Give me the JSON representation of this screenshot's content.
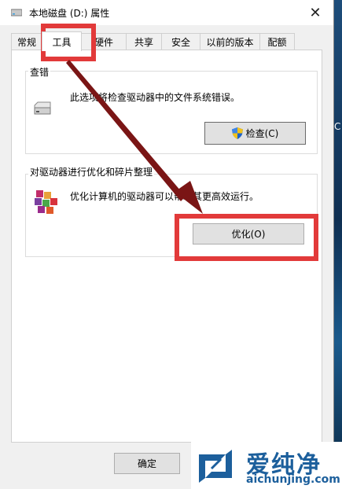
{
  "window": {
    "title": "本地磁盘 (D:) 属性",
    "close_glyph": "✕"
  },
  "tabs": [
    {
      "label": "常规"
    },
    {
      "label": "工具",
      "active": true
    },
    {
      "label": "硬件"
    },
    {
      "label": "共享"
    },
    {
      "label": "安全"
    },
    {
      "label": "以前的版本"
    },
    {
      "label": "配额"
    }
  ],
  "error_check": {
    "group_label": "查错",
    "description": "此选项将检查驱动器中的文件系统错误。",
    "button_label": "检查(C)",
    "icon": "drive-icon",
    "button_icon": "uac-shield-icon"
  },
  "optimize": {
    "group_label": "对驱动器进行优化和碎片整理",
    "description": "优化计算机的驱动器可以帮助其更高效运行。",
    "button_label": "优化(O)",
    "icon": "defrag-icon"
  },
  "footer": {
    "ok_label": "确定"
  },
  "desktop": {
    "edge_text": "C"
  },
  "watermark": {
    "brand_cn": "爱纯净",
    "url": "aichunjing.com"
  },
  "colors": {
    "highlight_red": "#e23a3a",
    "arrow": "#7a1515",
    "focus_blue": "#0078d7",
    "watermark_blue": "#1c5f9c"
  }
}
